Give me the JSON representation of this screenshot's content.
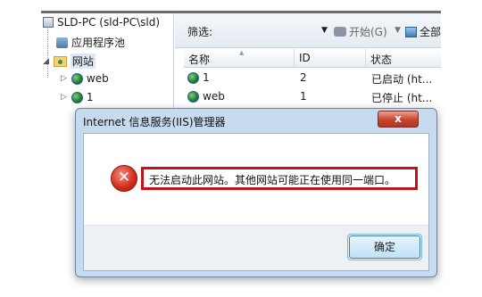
{
  "tree": {
    "server": "SLD-PC (sld-PC\\sld)",
    "app_pools": "应用程序池",
    "sites": "网站",
    "site_web": "web",
    "site_1": "1"
  },
  "toolbar": {
    "filter_label": "筛选:",
    "start_label": "开始(G)",
    "show_all_label": "全部"
  },
  "grid": {
    "headers": [
      "名称",
      "ID",
      "状态"
    ],
    "rows": [
      {
        "name": "1",
        "id": "2",
        "status": "已启动 (ht..."
      },
      {
        "name": "web",
        "id": "1",
        "status": "已停止 (ht..."
      }
    ]
  },
  "dialog": {
    "title": "Internet 信息服务(IIS)管理器",
    "close": "x",
    "message": "无法启动此网站。其他网站可能正在使用同一端口。",
    "ok": "确定"
  }
}
